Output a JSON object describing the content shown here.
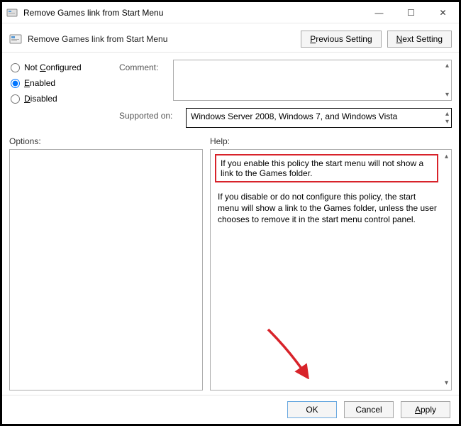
{
  "window": {
    "title": "Remove Games link from Start Menu",
    "controls": {
      "min": "—",
      "max": "☐",
      "close": "✕"
    }
  },
  "header": {
    "title": "Remove Games link from Start Menu",
    "prev_label": "Previous Setting",
    "next_label": "Next Setting"
  },
  "radios": {
    "not_configured": "Not Configured",
    "enabled": "Enabled",
    "disabled": "Disabled"
  },
  "labels": {
    "comment": "Comment:",
    "supported": "Supported on:",
    "options": "Options:",
    "help": "Help:"
  },
  "supported_text": "Windows Server 2008, Windows 7, and Windows Vista",
  "help": {
    "highlight": "If you enable this policy the start menu will not show a link to the Games folder.",
    "body": "If you disable or do not configure this policy, the start menu will show a link to the Games folder, unless the user chooses to remove it in the start menu control panel."
  },
  "buttons": {
    "ok": "OK",
    "cancel": "Cancel",
    "apply": "Apply"
  }
}
